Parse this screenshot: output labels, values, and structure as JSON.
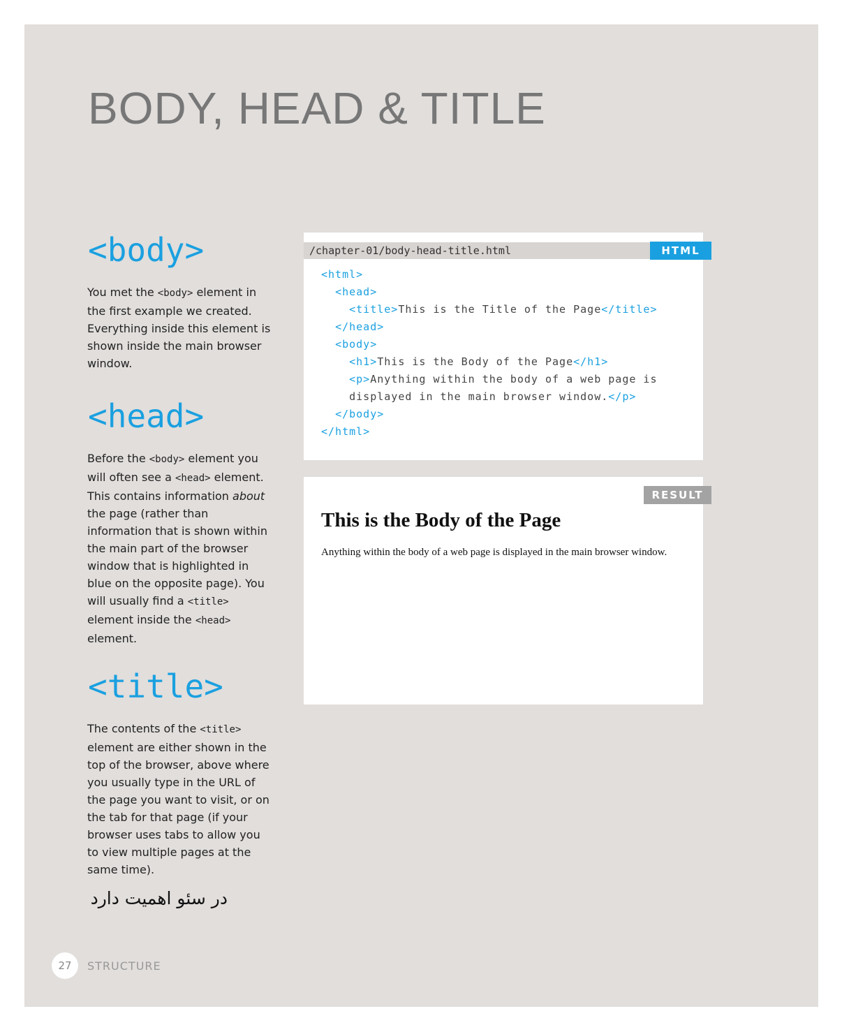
{
  "page": {
    "title": "BODY, HEAD & TITLE",
    "number": "27",
    "section": "STRUCTURE"
  },
  "sections": [
    {
      "heading": "<body>",
      "paragraph": [
        {
          "t": "You met the "
        },
        {
          "t": "<body>",
          "code": true
        },
        {
          "t": " element in the first example we created. Everything inside this element is shown inside the main browser window."
        }
      ]
    },
    {
      "heading": "<head>",
      "paragraph": [
        {
          "t": "Before the "
        },
        {
          "t": "<body>",
          "code": true
        },
        {
          "t": " element you will often see a "
        },
        {
          "t": "<head>",
          "code": true
        },
        {
          "t": " element. This contains information "
        },
        {
          "t": "about",
          "em": true
        },
        {
          "t": " the page (rather than information that is shown within the main part of the browser window that is highlighted in blue on the opposite page). You will usually find a "
        },
        {
          "t": "<title>",
          "code": true
        },
        {
          "t": " element inside the "
        },
        {
          "t": "<head>",
          "code": true
        },
        {
          "t": " element."
        }
      ]
    },
    {
      "heading": "<title>",
      "paragraph": [
        {
          "t": "The contents of the "
        },
        {
          "t": "<title>",
          "code": true
        },
        {
          "t": " element are either shown in the top of the browser, above where you usually type in the URL of the page you want to visit, or on the tab for that page (if your browser uses tabs to allow you to view multiple pages at the same time)."
        }
      ]
    }
  ],
  "persian_note": "در سئو اهمیت دارد",
  "code_panel": {
    "filename": "/chapter-01/body-head-title.html",
    "badge": "HTML",
    "lines": [
      [
        {
          "t": "<html>",
          "tag": true
        }
      ],
      [
        {
          "t": "  "
        },
        {
          "t": "<head>",
          "tag": true
        }
      ],
      [
        {
          "t": "    "
        },
        {
          "t": "<title>",
          "tag": true
        },
        {
          "t": "This is the Title of the Page"
        },
        {
          "t": "</title>",
          "tag": true
        }
      ],
      [
        {
          "t": "  "
        },
        {
          "t": "</head>",
          "tag": true
        }
      ],
      [
        {
          "t": "  "
        },
        {
          "t": "<body>",
          "tag": true
        }
      ],
      [
        {
          "t": "    "
        },
        {
          "t": "<h1>",
          "tag": true
        },
        {
          "t": "This is the Body of the Page"
        },
        {
          "t": "</h1>",
          "tag": true
        }
      ],
      [
        {
          "t": "    "
        },
        {
          "t": "<p>",
          "tag": true
        },
        {
          "t": "Anything within the body of a web page is"
        }
      ],
      [
        {
          "t": "    displayed in the main browser window."
        },
        {
          "t": "</p>",
          "tag": true
        }
      ],
      [
        {
          "t": "  "
        },
        {
          "t": "</body>",
          "tag": true
        }
      ],
      [
        {
          "t": "</html>",
          "tag": true
        }
      ]
    ]
  },
  "result_panel": {
    "badge": "RESULT",
    "heading": "This is the Body of the Page",
    "text": "Anything within the body of a web page is displayed in the main browser window."
  }
}
